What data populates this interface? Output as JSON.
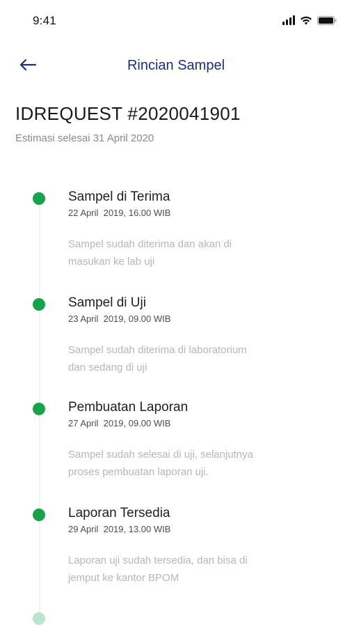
{
  "status_bar": {
    "time": "9:41"
  },
  "header": {
    "title": "Rincian Sampel",
    "back_icon": "arrow-left-icon",
    "accent_color": "#1d2f7a"
  },
  "request": {
    "id": "IDREQUEST #2020041901",
    "estimate": "Estimasi selesai 31 April 2020"
  },
  "timeline": {
    "done_color": "#16a34a",
    "pending_color": "#b9e4cf",
    "steps": [
      {
        "title": "Sampel di Terima",
        "date": "22 April  2019, 16.00 WIB",
        "description": "Sampel sudah diterima dan akan di\nmasukan ke lab uji",
        "status": "done"
      },
      {
        "title": "Sampel di Uji",
        "date": "23 April  2019, 09.00 WIB",
        "description": "Sampel sudah diterima di laboratorium\ndan  sedang di uji",
        "status": "done"
      },
      {
        "title": "Pembuatan Laporan",
        "date": "27 April  2019, 09.00 WIB",
        "description": "Sampel sudah selesai di uji, selanjutnya\nproses pembuatan laporan uji.",
        "status": "done"
      },
      {
        "title": "Laporan Tersedia",
        "date": "29 April  2019, 13.00 WIB",
        "description": "Laporan uji sudah tersedia, dan bisa di\njemput ke kantor BPOM",
        "status": "done"
      },
      {
        "status": "pending"
      }
    ]
  }
}
